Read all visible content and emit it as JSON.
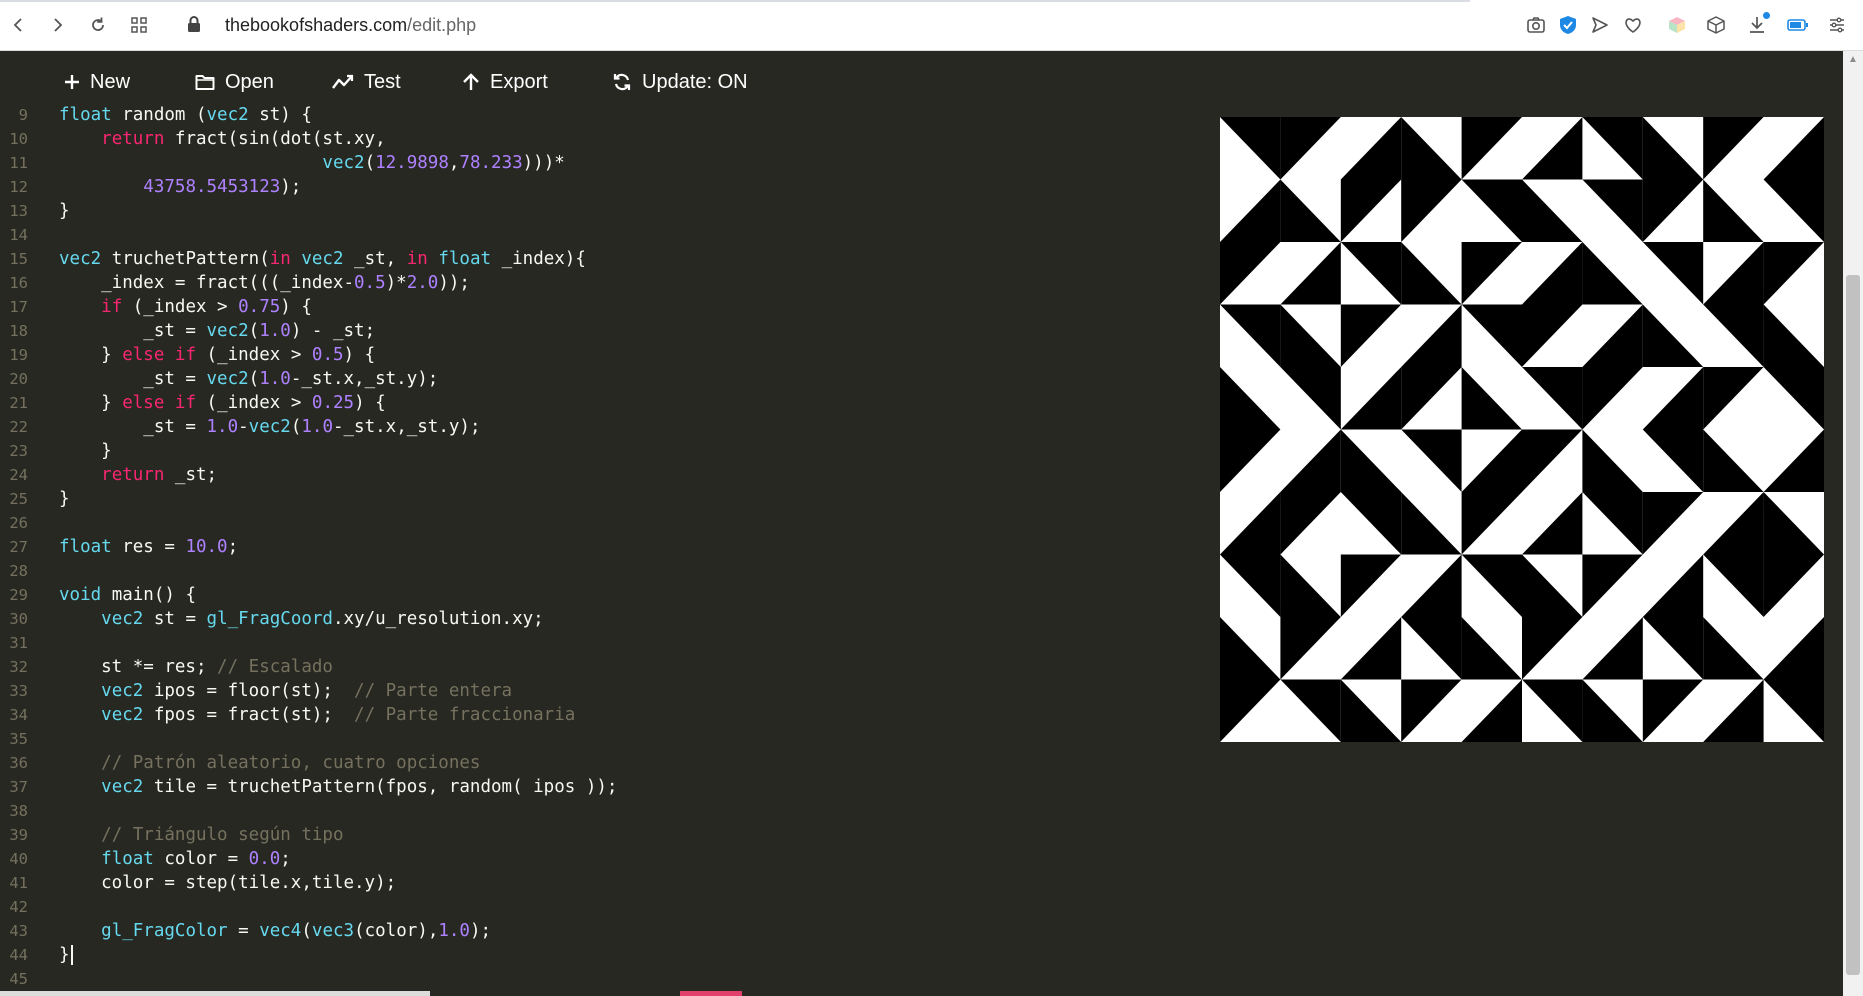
{
  "browser": {
    "url_domain": "thebookofshaders.com",
    "url_path": "/edit.php",
    "icons": [
      "back-icon",
      "forward-icon",
      "reload-icon",
      "tab-grid-icon",
      "lock-icon",
      "camera-icon",
      "shield-icon",
      "send-icon",
      "heart-icon",
      "cube-color-icon",
      "box-icon",
      "download-icon",
      "battery-icon",
      "settings-sliders-icon"
    ]
  },
  "menu": {
    "new_label": "New",
    "open_label": "Open",
    "test_label": "Test",
    "export_label": "Export",
    "update_label": "Update: ON"
  },
  "editor": {
    "lines": [
      {
        "n": "9",
        "tokens": [
          [
            "ty",
            "float"
          ],
          [
            "t",
            " random ("
          ],
          [
            "ty",
            "vec2"
          ],
          [
            "t",
            " st) {"
          ]
        ]
      },
      {
        "n": "10",
        "tokens": [
          [
            "t",
            "    "
          ],
          [
            "kw",
            "return"
          ],
          [
            "t",
            " fract(sin(dot(st.xy,"
          ]
        ]
      },
      {
        "n": "11",
        "tokens": [
          [
            "t",
            "                         "
          ],
          [
            "ty",
            "vec2"
          ],
          [
            "t",
            "("
          ],
          [
            "num",
            "12.9898"
          ],
          [
            "t",
            ","
          ],
          [
            "num",
            "78.233"
          ],
          [
            "t",
            ")))*"
          ]
        ]
      },
      {
        "n": "12",
        "tokens": [
          [
            "t",
            "        "
          ],
          [
            "num",
            "43758.5453123"
          ],
          [
            "t",
            ");"
          ]
        ]
      },
      {
        "n": "13",
        "tokens": [
          [
            "t",
            "}"
          ]
        ]
      },
      {
        "n": "14",
        "tokens": []
      },
      {
        "n": "15",
        "tokens": [
          [
            "ty",
            "vec2"
          ],
          [
            "t",
            " truchetPattern("
          ],
          [
            "kw",
            "in"
          ],
          [
            "t",
            " "
          ],
          [
            "ty",
            "vec2"
          ],
          [
            "t",
            " _st, "
          ],
          [
            "kw",
            "in"
          ],
          [
            "t",
            " "
          ],
          [
            "ty",
            "float"
          ],
          [
            "t",
            " _index){"
          ]
        ]
      },
      {
        "n": "16",
        "tokens": [
          [
            "t",
            "    _index = fract(((_index-"
          ],
          [
            "num",
            "0.5"
          ],
          [
            "t",
            ")*"
          ],
          [
            "num",
            "2.0"
          ],
          [
            "t",
            "));"
          ]
        ]
      },
      {
        "n": "17",
        "tokens": [
          [
            "t",
            "    "
          ],
          [
            "kw",
            "if"
          ],
          [
            "t",
            " (_index > "
          ],
          [
            "num",
            "0.75"
          ],
          [
            "t",
            ") {"
          ]
        ]
      },
      {
        "n": "18",
        "tokens": [
          [
            "t",
            "        _st = "
          ],
          [
            "ty",
            "vec2"
          ],
          [
            "t",
            "("
          ],
          [
            "num",
            "1.0"
          ],
          [
            "t",
            ") - _st;"
          ]
        ]
      },
      {
        "n": "19",
        "tokens": [
          [
            "t",
            "    } "
          ],
          [
            "kw",
            "else"
          ],
          [
            "t",
            " "
          ],
          [
            "kw",
            "if"
          ],
          [
            "t",
            " (_index > "
          ],
          [
            "num",
            "0.5"
          ],
          [
            "t",
            ") {"
          ]
        ]
      },
      {
        "n": "20",
        "tokens": [
          [
            "t",
            "        _st = "
          ],
          [
            "ty",
            "vec2"
          ],
          [
            "t",
            "("
          ],
          [
            "num",
            "1.0"
          ],
          [
            "t",
            "-_st.x,_st.y);"
          ]
        ]
      },
      {
        "n": "21",
        "tokens": [
          [
            "t",
            "    } "
          ],
          [
            "kw",
            "else"
          ],
          [
            "t",
            " "
          ],
          [
            "kw",
            "if"
          ],
          [
            "t",
            " (_index > "
          ],
          [
            "num",
            "0.25"
          ],
          [
            "t",
            ") {"
          ]
        ]
      },
      {
        "n": "22",
        "tokens": [
          [
            "t",
            "        _st = "
          ],
          [
            "num",
            "1.0"
          ],
          [
            "t",
            "-"
          ],
          [
            "ty",
            "vec2"
          ],
          [
            "t",
            "("
          ],
          [
            "num",
            "1.0"
          ],
          [
            "t",
            "-_st.x,_st.y);"
          ]
        ]
      },
      {
        "n": "23",
        "tokens": [
          [
            "t",
            "    }"
          ]
        ]
      },
      {
        "n": "24",
        "tokens": [
          [
            "t",
            "    "
          ],
          [
            "kw",
            "return"
          ],
          [
            "t",
            " _st;"
          ]
        ]
      },
      {
        "n": "25",
        "tokens": [
          [
            "t",
            "}"
          ]
        ]
      },
      {
        "n": "26",
        "tokens": []
      },
      {
        "n": "27",
        "tokens": [
          [
            "ty",
            "float"
          ],
          [
            "t",
            " res = "
          ],
          [
            "num",
            "10.0"
          ],
          [
            "t",
            ";"
          ]
        ]
      },
      {
        "n": "28",
        "tokens": []
      },
      {
        "n": "29",
        "tokens": [
          [
            "ty",
            "void"
          ],
          [
            "t",
            " main() {"
          ]
        ]
      },
      {
        "n": "30",
        "tokens": [
          [
            "t",
            "    "
          ],
          [
            "ty",
            "vec2"
          ],
          [
            "t",
            " st = "
          ],
          [
            "ty",
            "gl_FragCoord"
          ],
          [
            "t",
            ".xy/u_resolution.xy;"
          ]
        ]
      },
      {
        "n": "31",
        "tokens": []
      },
      {
        "n": "32",
        "tokens": [
          [
            "t",
            "    st *= res; "
          ],
          [
            "cm",
            "// Escalado"
          ]
        ]
      },
      {
        "n": "33",
        "tokens": [
          [
            "t",
            "    "
          ],
          [
            "ty",
            "vec2"
          ],
          [
            "t",
            " ipos = floor(st);  "
          ],
          [
            "cm",
            "// Parte entera"
          ]
        ]
      },
      {
        "n": "34",
        "tokens": [
          [
            "t",
            "    "
          ],
          [
            "ty",
            "vec2"
          ],
          [
            "t",
            " fpos = fract(st);  "
          ],
          [
            "cm",
            "// Parte fraccionaria"
          ]
        ]
      },
      {
        "n": "35",
        "tokens": []
      },
      {
        "n": "36",
        "tokens": [
          [
            "t",
            "    "
          ],
          [
            "cm",
            "// Patrón aleatorio, cuatro opciones"
          ]
        ]
      },
      {
        "n": "37",
        "tokens": [
          [
            "t",
            "    "
          ],
          [
            "ty",
            "vec2"
          ],
          [
            "t",
            " tile = truchetPattern(fpos, random( ipos ));"
          ]
        ]
      },
      {
        "n": "38",
        "tokens": []
      },
      {
        "n": "39",
        "tokens": [
          [
            "t",
            "    "
          ],
          [
            "cm",
            "// Triángulo según tipo"
          ]
        ]
      },
      {
        "n": "40",
        "tokens": [
          [
            "t",
            "    "
          ],
          [
            "ty",
            "float"
          ],
          [
            "t",
            " color = "
          ],
          [
            "num",
            "0.0"
          ],
          [
            "t",
            ";"
          ]
        ]
      },
      {
        "n": "41",
        "tokens": [
          [
            "t",
            "    color = step(tile.x,tile.y);"
          ]
        ]
      },
      {
        "n": "42",
        "tokens": []
      },
      {
        "n": "43",
        "tokens": [
          [
            "t",
            "    "
          ],
          [
            "ty",
            "gl_FragColor"
          ],
          [
            "t",
            " = "
          ],
          [
            "ty",
            "vec4"
          ],
          [
            "t",
            "("
          ],
          [
            "ty",
            "vec3"
          ],
          [
            "t",
            "(color),"
          ],
          [
            "num",
            "1.0"
          ],
          [
            "t",
            ");"
          ]
        ]
      },
      {
        "n": "44",
        "tokens": [
          [
            "t",
            "}"
          ]
        ],
        "cursor": true
      },
      {
        "n": "45",
        "tokens": []
      }
    ]
  },
  "preview": {
    "grid_size": 10,
    "foreground": "#000000",
    "background": "#ffffff",
    "tiles": [
      "1023021302",
      "2300131031",
      "0213023120",
      "1302102313",
      "3120310201",
      "0231203132",
      "2013021023",
      "1302130210",
      "3021302132",
      "0130213021"
    ]
  },
  "colors": {
    "editor_bg": "#272822",
    "keyword": "#f92672",
    "type": "#66d9ef",
    "number": "#ae81ff",
    "comment": "#75715e"
  }
}
